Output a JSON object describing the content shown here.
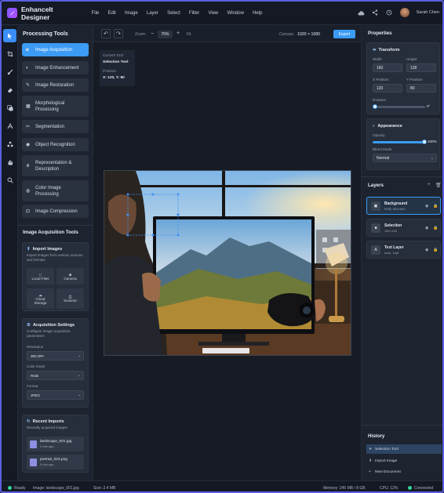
{
  "app": {
    "title": "EnhanceIt Designer",
    "user": "Sarah Chen"
  },
  "menu": [
    "File",
    "Edit",
    "Image",
    "Layer",
    "Select",
    "Filter",
    "View",
    "Window",
    "Help"
  ],
  "left": {
    "heading": "Processing Tools",
    "tools": [
      {
        "label": "Image Acquisition",
        "icon": "camera-icon"
      },
      {
        "label": "Image Enhancement",
        "icon": "contrast-icon"
      },
      {
        "label": "Image Restoration",
        "icon": "brush-icon"
      },
      {
        "label": "Morphological Processing",
        "icon": "grid-icon"
      },
      {
        "label": "Segmentation",
        "icon": "scissors-icon"
      },
      {
        "label": "Object Recognition",
        "icon": "eye-icon"
      },
      {
        "label": "Representation & Description",
        "icon": "nodes-icon"
      },
      {
        "label": "Color Image Processing",
        "icon": "palette-icon"
      },
      {
        "label": "Image Compression",
        "icon": "compress-icon"
      }
    ],
    "acq_heading": "Image Acquisition Tools",
    "import": {
      "title": "Import Images",
      "desc": "Import images from various sources and formats",
      "buttons": [
        "Local Files",
        "Camera",
        "Cloud Storage",
        "Scanner"
      ]
    },
    "settings": {
      "title": "Acquisition Settings",
      "desc": "Configure image acquisition parameters",
      "resolution_label": "Resolution",
      "resolution_value": "300 DPI",
      "color_label": "Color Mode",
      "color_value": "RGB",
      "format_label": "Format",
      "format_value": "JPEG"
    },
    "recent": {
      "title": "Recent Imports",
      "desc": "Recently acquired images",
      "items": [
        {
          "name": "landscape_001.jpg",
          "time": "2 min ago"
        },
        {
          "name": "portrait_023.png",
          "time": "5 min ago"
        }
      ]
    }
  },
  "toolbar": {
    "zoom_label": "Zoom:",
    "zoom_value": "75%",
    "fit": "Fit",
    "canvas_label": "Canvas:",
    "canvas_value": "1920 × 1080",
    "export": "Export"
  },
  "info": {
    "current_label": "Current Tool",
    "current_value": "Selection Tool",
    "position_label": "Position",
    "position_value": "X: 120, Y: 80"
  },
  "properties": {
    "heading": "Properties",
    "transform": {
      "title": "Transform",
      "width_label": "Width",
      "width": "160",
      "height_label": "Height",
      "height": "128",
      "x_label": "X Position",
      "x": "120",
      "y_label": "Y Position",
      "y": "80",
      "rotation_label": "Rotation",
      "rotation": "0°",
      "rotation_fraction": 0.0
    },
    "appearance": {
      "title": "Appearance",
      "opacity_label": "Opacity",
      "opacity": "100%",
      "opacity_fraction": 1.0,
      "blend_label": "Blend Mode",
      "blend": "Normal"
    }
  },
  "layers": {
    "heading": "Layers",
    "items": [
      {
        "name": "Background",
        "sub": "RGB, 800×600",
        "icon": "image-icon"
      },
      {
        "name": "Selection",
        "sub": "160×128",
        "icon": "square-icon"
      },
      {
        "name": "Text Layer",
        "sub": "Arial, 14pt",
        "icon": "text-icon"
      }
    ]
  },
  "history": {
    "heading": "History",
    "items": [
      {
        "label": "Selection Tool",
        "icon": "cursor-icon"
      },
      {
        "label": "Import Image",
        "icon": "upload-icon"
      },
      {
        "label": "New Document",
        "icon": "plus-icon"
      }
    ]
  },
  "status": {
    "ready": "Ready",
    "image": "Image: landscape_001.jpg",
    "size": "Size: 2.4 MB",
    "memory": "Memory: 245 MB / 8 GB",
    "cpu": "CPU: 12%",
    "connected": "Connected"
  }
}
